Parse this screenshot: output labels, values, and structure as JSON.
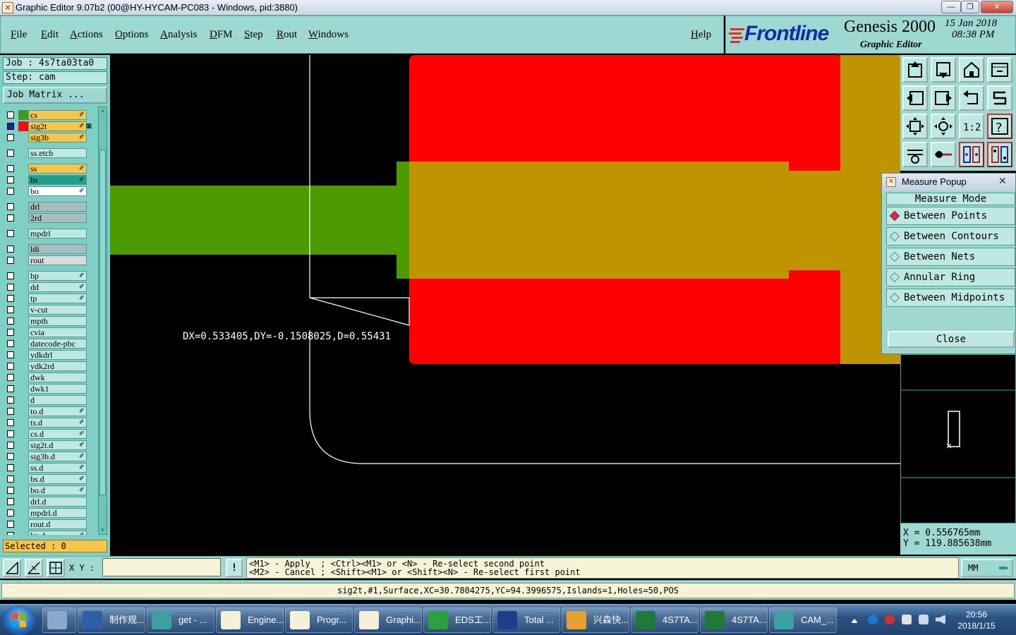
{
  "window": {
    "title": "Graphic Editor 9.07b2 (00@HY-HYCAM-PC083 - Windows, pid:3880)",
    "controls": {
      "minimize": "—",
      "maximize": "❐",
      "close": "✕"
    }
  },
  "menu": {
    "items": [
      "File",
      "Edit",
      "Actions",
      "Options",
      "Analysis",
      "DFM",
      "Step",
      "Rout",
      "Windows"
    ],
    "help": "Help"
  },
  "brand": {
    "company": "Frontline",
    "product": "Genesis 2000",
    "subtitle": "Graphic Editor",
    "date": "15 Jan 2018",
    "time": "08:38 PM"
  },
  "job": {
    "job_label": "Job : 4s7ta03ta0",
    "step_label": "Step: cam",
    "matrix_button": "Job Matrix ..."
  },
  "layers": [
    {
      "name": "cs",
      "color": "#f6c64c",
      "swatch": "#3c9a28",
      "edit": "✐"
    },
    {
      "name": "sig2t",
      "color": "#f6c64c",
      "swatch": "#f01010",
      "edit": "✐ ▦",
      "checked_blue": true
    },
    {
      "name": "sig3b",
      "color": "#f6c64c",
      "swatch": "",
      "edit": "✐"
    },
    {
      "name": "ss.etch",
      "color": "#bfe8e3",
      "swatch": "",
      "edit": ""
    },
    {
      "name": "ss",
      "color": "#f6c64c",
      "swatch": "",
      "edit": "✐"
    },
    {
      "name": "bs",
      "color": "#1ea08c",
      "swatch": "",
      "edit": "✐"
    },
    {
      "name": "bo",
      "color": "#ffffff",
      "swatch": "",
      "edit": "✐"
    },
    {
      "name": "drl",
      "color": "#a9bcc0",
      "swatch": "",
      "edit": ""
    },
    {
      "name": "2rd",
      "color": "#a9bcc0",
      "swatch": "",
      "edit": ""
    },
    {
      "name": "mpdrl",
      "color": "#bfe8e3",
      "swatch": "",
      "edit": ""
    },
    {
      "name": "ldi",
      "color": "#a9bcc0",
      "swatch": "",
      "edit": ""
    },
    {
      "name": "rout",
      "color": "#dcdcdc",
      "swatch": "",
      "edit": ""
    },
    {
      "name": "bp",
      "color": "#bfe8e3",
      "swatch": "",
      "edit": "✐"
    },
    {
      "name": "dd",
      "color": "#bfe8e3",
      "swatch": "",
      "edit": "✐"
    },
    {
      "name": "tp",
      "color": "#bfe8e3",
      "swatch": "",
      "edit": "✐"
    },
    {
      "name": "v-cut",
      "color": "#bfe8e3",
      "swatch": "",
      "edit": ""
    },
    {
      "name": "mpth",
      "color": "#bfe8e3",
      "swatch": "",
      "edit": ""
    },
    {
      "name": "cvia",
      "color": "#bfe8e3",
      "swatch": "",
      "edit": ""
    },
    {
      "name": "datecode-pbc",
      "color": "#bfe8e3",
      "swatch": "",
      "edit": ""
    },
    {
      "name": "ydkdrl",
      "color": "#bfe8e3",
      "swatch": "",
      "edit": ""
    },
    {
      "name": "ydk2rd",
      "color": "#bfe8e3",
      "swatch": "",
      "edit": ""
    },
    {
      "name": "dwk",
      "color": "#bfe8e3",
      "swatch": "",
      "edit": ""
    },
    {
      "name": "dwk1",
      "color": "#bfe8e3",
      "swatch": "",
      "edit": ""
    },
    {
      "name": "d",
      "color": "#bfe8e3",
      "swatch": "",
      "edit": ""
    },
    {
      "name": "to.d",
      "color": "#bfe8e3",
      "swatch": "",
      "edit": "✐"
    },
    {
      "name": "ts.d",
      "color": "#bfe8e3",
      "swatch": "",
      "edit": "✐"
    },
    {
      "name": "cs.d",
      "color": "#bfe8e3",
      "swatch": "",
      "edit": "✐"
    },
    {
      "name": "sig2t.d",
      "color": "#bfe8e3",
      "swatch": "",
      "edit": "✐"
    },
    {
      "name": "sig3b.d",
      "color": "#bfe8e3",
      "swatch": "",
      "edit": "✐"
    },
    {
      "name": "ss.d",
      "color": "#bfe8e3",
      "swatch": "",
      "edit": "✐"
    },
    {
      "name": "bs.d",
      "color": "#bfe8e3",
      "swatch": "",
      "edit": "✐"
    },
    {
      "name": "bo.d",
      "color": "#bfe8e3",
      "swatch": "",
      "edit": "✐"
    },
    {
      "name": "drl.d",
      "color": "#bfe8e3",
      "swatch": "",
      "edit": ""
    },
    {
      "name": "mpdrl.d",
      "color": "#bfe8e3",
      "swatch": "",
      "edit": ""
    },
    {
      "name": "rout.d",
      "color": "#bfe8e3",
      "swatch": "",
      "edit": ""
    },
    {
      "name": "bp.d",
      "color": "#bfe8e3",
      "swatch": "",
      "edit": "✐"
    }
  ],
  "selected_label": "Selected : 0",
  "canvas": {
    "measure_text": "DX=0.533405,DY=-0.1508025,D=0.55431",
    "colors": {
      "red": "#ff0000",
      "olive": "#c09400",
      "green": "#4a9a00",
      "outline": "#ffffff"
    }
  },
  "measure_popup": {
    "title": "Measure Popup",
    "mode_header": "Measure Mode",
    "options": [
      {
        "label": "Between Points",
        "selected": true
      },
      {
        "label": "Between Contours",
        "selected": false
      },
      {
        "label": "Between Nets",
        "selected": false
      },
      {
        "label": "Annular Ring",
        "selected": false
      },
      {
        "label": "Between Midpoints",
        "selected": false
      }
    ],
    "close_label": "Close"
  },
  "coords": {
    "x": "X = 0.556765mm",
    "y": "Y = 119.885638mm"
  },
  "command": {
    "xy_label": "X Y :",
    "xy_value": "",
    "bang": "!",
    "hint_line1": "<M1> - Apply  ; <Ctrl><M1> or <N> - Re-select second point",
    "hint_line2": "<M2> - Cancel ; <Shift><M1> or <Shift><N> - Re-select first point",
    "units": "MM"
  },
  "status": "sig2t,#1,Surface,XC=30.7804275,YC=94.3996575,Islands=1,Holes=50,POS",
  "taskbar": {
    "items": [
      {
        "label": "",
        "icon": "calculator-icon",
        "color": "#8aa8c8"
      },
      {
        "label": "制作规...",
        "icon": "document-icon",
        "color": "#2d5fa8"
      },
      {
        "label": "get - ...",
        "icon": "cam-icon",
        "color": "#3aa0a0"
      },
      {
        "label": "Engine...",
        "icon": "genesis-icon",
        "color": "#f5f0d8"
      },
      {
        "label": "Progr...",
        "icon": "genesis-icon",
        "color": "#f5f0d8"
      },
      {
        "label": "Graphi...",
        "icon": "genesis-icon",
        "color": "#f5f0d8"
      },
      {
        "label": "EDS工...",
        "icon": "f-icon",
        "color": "#2aa040"
      },
      {
        "label": "Total ...",
        "icon": "floppy-icon",
        "color": "#1c3f8a"
      },
      {
        "label": "兴森快...",
        "icon": "shell-icon",
        "color": "#e8a030"
      },
      {
        "label": "4S7TA...",
        "icon": "excel-icon",
        "color": "#1f7a3a"
      },
      {
        "label": "4S7TA...",
        "icon": "excel-icon",
        "color": "#1f7a3a"
      },
      {
        "label": "CAM_...",
        "icon": "cam-icon",
        "color": "#3aa0a0"
      }
    ],
    "time": "20:56",
    "date": "2018/1/15"
  }
}
